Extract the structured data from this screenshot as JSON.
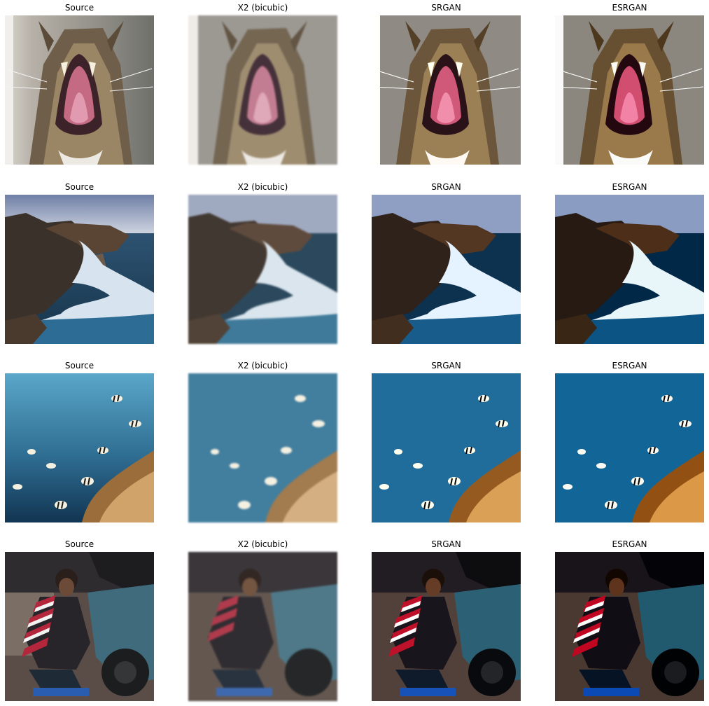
{
  "rows": [
    {
      "scene": "cat",
      "panels": [
        {
          "title": "Source",
          "variant": "source"
        },
        {
          "title": "X2 (bicubic)",
          "variant": "blur"
        },
        {
          "title": "SRGAN",
          "variant": "srgan"
        },
        {
          "title": "ESRGAN",
          "variant": "esrgan"
        }
      ]
    },
    {
      "scene": "sea-rocks",
      "panels": [
        {
          "title": "Source",
          "variant": "source"
        },
        {
          "title": "X2 (bicubic)",
          "variant": "blur"
        },
        {
          "title": "SRGAN",
          "variant": "srgan"
        },
        {
          "title": "ESRGAN",
          "variant": "esrgan"
        }
      ]
    },
    {
      "scene": "fish-reef",
      "panels": [
        {
          "title": "Source",
          "variant": "source"
        },
        {
          "title": "X2 (bicubic)",
          "variant": "blur"
        },
        {
          "title": "SRGAN",
          "variant": "srgan"
        },
        {
          "title": "ESRGAN",
          "variant": "esrgan"
        }
      ]
    },
    {
      "scene": "man-scooter",
      "panels": [
        {
          "title": "Source",
          "variant": "source"
        },
        {
          "title": "X2 (bicubic)",
          "variant": "blur"
        },
        {
          "title": "SRGAN",
          "variant": "srgan"
        },
        {
          "title": "ESRGAN",
          "variant": "esrgan"
        }
      ]
    }
  ],
  "palette": {
    "cat_fur": "#7a6a55",
    "cat_mouth": "#c46b83",
    "sky": "#8fa0bf",
    "rock": "#4a3a2e",
    "sea": "#2a4f72",
    "foam": "#d7e4ef",
    "water_top": "#5aa7c9",
    "water_bottom": "#123552",
    "reef": "#9b6d3b",
    "scooter": "#3f6b7c",
    "shirt_red": "#b3263b"
  }
}
